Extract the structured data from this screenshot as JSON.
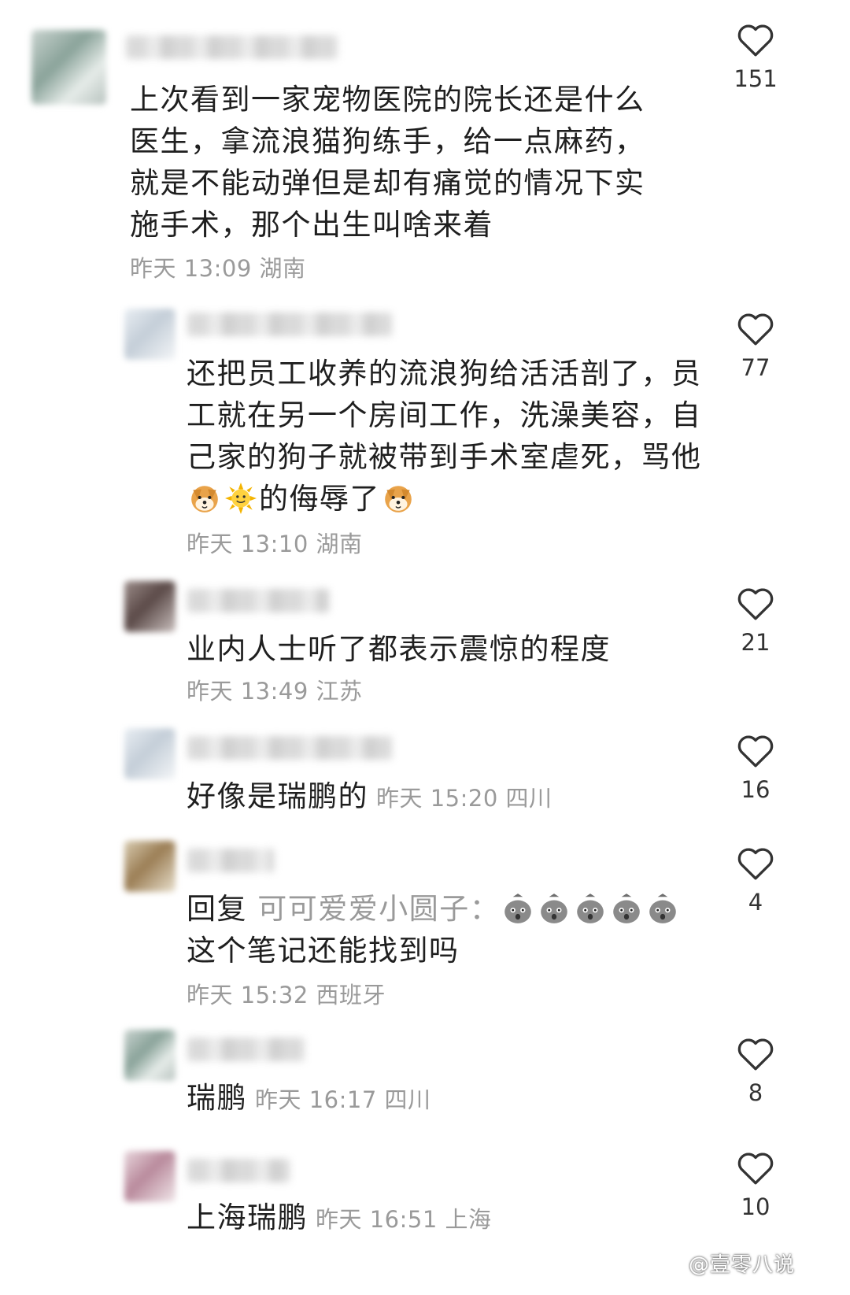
{
  "comments": [
    {
      "text": "上次看到一家宠物医院的院长还是什么医生，拿流浪猫狗练手，给一点麻药，就是不能动弹但是却有痛觉的情况下实施手术，那个出生叫啥来着",
      "time": "昨天 13:09",
      "location": "湖南",
      "likes": "151"
    },
    {
      "text_a": "还把员工收养的流浪狗给活活剖了，员工就在另一个房间工作，洗澡美容，自己家的狗子就被带到手术室虐死，骂他",
      "text_b": "的侮辱了",
      "time": "昨天 13:10",
      "location": "湖南",
      "likes": "77",
      "emojis": [
        "dog-face-emoji",
        "sun-emoji",
        "dog-face-emoji"
      ]
    },
    {
      "text": "业内人士听了都表示震惊的程度",
      "time": "昨天 13:49",
      "location": "江苏",
      "likes": "21"
    },
    {
      "text": "好像是瑞鹏的",
      "time": "昨天 15:20",
      "location": "四川",
      "likes": "16"
    },
    {
      "reply_prefix": "回复",
      "reply_to": "可可爱爱小圆子：",
      "text": "这个笔记还能找到吗",
      "time": "昨天 15:32",
      "location": "西班牙",
      "likes": "4",
      "emojis": [
        "shocked-bag-emoji"
      ]
    },
    {
      "text": "瑞鹏",
      "time": "昨天 16:17",
      "location": "四川",
      "likes": "8"
    },
    {
      "text": "上海瑞鹏",
      "time": "昨天 16:51",
      "location": "上海",
      "likes": "10"
    }
  ],
  "watermark": "@壹零八说"
}
